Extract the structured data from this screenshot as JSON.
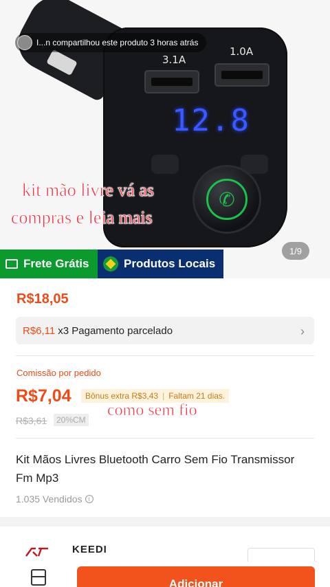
{
  "share_banner": {
    "text": "I...n compartilhou este produto 3 horas atrás"
  },
  "product_image": {
    "usb_left_label": "3.1A",
    "usb_right_label": "1.0A",
    "display_value": "12.8",
    "page_counter": "1/9"
  },
  "overlay_texts": {
    "line1": "kit mão livre vá as",
    "line2": "compras e leia mais",
    "line3": "como sem fio"
  },
  "tags": {
    "shipping": "Frete Grátis",
    "local": "Produtos Locais"
  },
  "price": "R$18,05",
  "installment": {
    "amount": "R$6,11",
    "text": "x3 Pagamento parcelado"
  },
  "commission": {
    "label": "Comissão por pedido",
    "value": "R$7,04",
    "bonus": "Bônus extra R$3,43",
    "days_left": "Faltam 21 dias.",
    "old_value": "R$3,61",
    "cm_badge": "20%CM"
  },
  "product_title": "Kit Mãos Livres Bluetooth Carro Sem Fio Transmissor Fm Mp3",
  "sold_count": "1.035 Vendidos",
  "store": {
    "logo_text": "KF",
    "name": "KEEDI"
  },
  "actions": {
    "add_label": "Adicionar"
  },
  "colors": {
    "accent": "#f04a18",
    "free_shipping": "#0b9a2e",
    "local_products": "#0a2f70",
    "overlay_text": "#ff2d3f"
  }
}
